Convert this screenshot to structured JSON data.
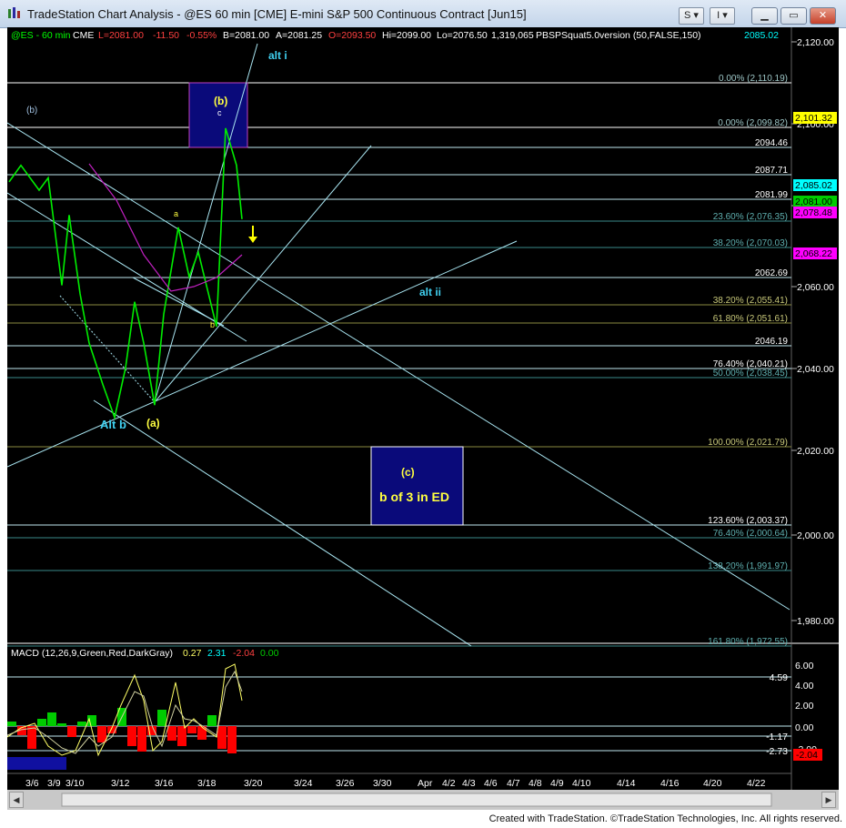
{
  "window": {
    "title": "TradeStation Chart Analysis - @ES 60 min [CME] E-mini S&P 500 Continuous Contract [Jun15]",
    "toolbar_btn_1": "S",
    "toolbar_btn_2": "I",
    "credit": "Created with TradeStation. ©TradeStation Technologies, Inc. All rights reserved."
  },
  "header": {
    "symbol": "@ES - 60 min",
    "exchange": "CME",
    "last": "L=2081.00",
    "change": "-11.50",
    "pct": "-0.55%",
    "bid": "B=2081.00",
    "ask": "A=2081.25",
    "open": "O=2093.50",
    "high": "Hi=2099.00",
    "low": "Lo=2076.50",
    "volume": "1,319,065",
    "indicator": "PBSPSquat5.0version (50,FALSE,150)",
    "indicator_value": "2085.02"
  },
  "price_axis": [
    "2,120.00",
    "2,100.00",
    "2,080.00",
    "2,060.00",
    "2,040.00",
    "2,020.00",
    "2,000.00",
    "1,980.00"
  ],
  "price_badges": [
    {
      "text": "2,101.32",
      "bg": "#ffff00",
      "fg": "#000000"
    },
    {
      "text": "2,085.02",
      "bg": "#00ffff",
      "fg": "#000000"
    },
    {
      "text": "2,081.00",
      "bg": "#00cc00",
      "fg": "#000000"
    },
    {
      "text": "2,078.48",
      "bg": "#ff00ff",
      "fg": "#000000"
    },
    {
      "text": "2,068.22",
      "bg": "#ff00ff",
      "fg": "#000000"
    }
  ],
  "levels": [
    {
      "text": "0.00% (2,110.19)",
      "color": "#9ec7c7",
      "line": "#ffffff"
    },
    {
      "text": "0.00% (2,099.82)",
      "color": "#9ec7c7",
      "line": "#ffffff"
    },
    {
      "text": "2094.46",
      "color": "#ffffff",
      "line": "#bfe8f0"
    },
    {
      "text": "2087.71",
      "color": "#ffffff",
      "line": "#bfe8f0"
    },
    {
      "text": "2081.99",
      "color": "#ffffff",
      "line": "#bfe8f0"
    },
    {
      "text": "23.60% (2,076.35)",
      "color": "#5fb0b0",
      "line": "#3a8a8a"
    },
    {
      "text": "38.20% (2,070.03)",
      "color": "#5fb0b0",
      "line": "#3a8a8a"
    },
    {
      "text": "2062.69",
      "color": "#ffffff",
      "line": "#bfe8f0"
    },
    {
      "text": "38.20% (2,055.41)",
      "color": "#c9c97a",
      "line": "#8a8a40"
    },
    {
      "text": "61.80% (2,051.61)",
      "color": "#c9c97a",
      "line": "#8a8a40"
    },
    {
      "text": "2046.19",
      "color": "#ffffff",
      "line": "#bfe8f0"
    },
    {
      "text": "76.40% (2,040.21)",
      "color": "#ffffff",
      "line": "#bfe8f0"
    },
    {
      "text": "50.00% (2,038.45)",
      "color": "#5fb0b0",
      "line": "#3a8a8a"
    },
    {
      "text": "100.00% (2,021.79)",
      "color": "#c9c97a",
      "line": "#8a8a40"
    },
    {
      "text": "123.60% (2,003.37)",
      "color": "#ffffff",
      "line": "#bfe8f0"
    },
    {
      "text": "76.40% (2,000.64)",
      "color": "#5fb0b0",
      "line": "#3a8a8a"
    },
    {
      "text": "138.20% (1,991.97)",
      "color": "#5fb0b0",
      "line": "#3a8a8a"
    },
    {
      "text": "161.80% (1,972.55)",
      "color": "#5fb0b0",
      "line": "#3a8a8a"
    }
  ],
  "annotations": {
    "alt_i": "alt i",
    "alt_ii": "alt ii",
    "b_paren_top": "(b)",
    "c_small": "c",
    "b_left": "(b)",
    "a_small": "a",
    "b_small": "b",
    "alt_b": "Alt b",
    "a_paren": "(a)",
    "c_paren": "(c)",
    "b_of_3": "b of 3 in ED"
  },
  "macd": {
    "label": "MACD (12,26,9,Green,Red,DarkGray)",
    "v1": "0.27",
    "v2": "2.31",
    "v3": "-2.04",
    "v4": "0.00",
    "axis": [
      "6.00",
      "4.00",
      "2.00",
      "0.00",
      "-2.00"
    ],
    "levels": [
      "4.59",
      "-1.17",
      "-2.73"
    ],
    "badge": "-2.04",
    "colors": {
      "hist_pos": "#00cc00",
      "hist_neg": "#ff0000",
      "line1": "#ffff66",
      "line2": "#d0d0a0"
    }
  },
  "date_axis": [
    "3/6",
    "3/9",
    "3/10",
    "3/12",
    "3/16",
    "3/18",
    "3/20",
    "3/24",
    "3/26",
    "3/30",
    "Apr",
    "4/2",
    "4/3",
    "4/6",
    "4/7",
    "4/8",
    "4/9",
    "4/10",
    "4/14",
    "4/16",
    "4/20",
    "4/22"
  ],
  "chart_data": {
    "type": "line",
    "title": "",
    "price_series": {
      "name": "@ES - 60 min",
      "x": [
        "3/5",
        "3/6",
        "3/6",
        "3/9",
        "3/9",
        "3/10",
        "3/10",
        "3/11",
        "3/11",
        "3/12",
        "3/12",
        "3/13",
        "3/13",
        "3/16",
        "3/16",
        "3/17",
        "3/17",
        "3/18",
        "3/18",
        "3/19",
        "3/19",
        "3/19"
      ],
      "y": [
        2087,
        2091,
        2085,
        2088,
        2062,
        2079,
        2060,
        2048,
        2038,
        2030,
        2042,
        2058,
        2048,
        2033,
        2055,
        2076,
        2064,
        2070,
        2052,
        2100,
        2091,
        2078
      ]
    },
    "ylim": [
      1975,
      2125
    ],
    "grid": false
  }
}
